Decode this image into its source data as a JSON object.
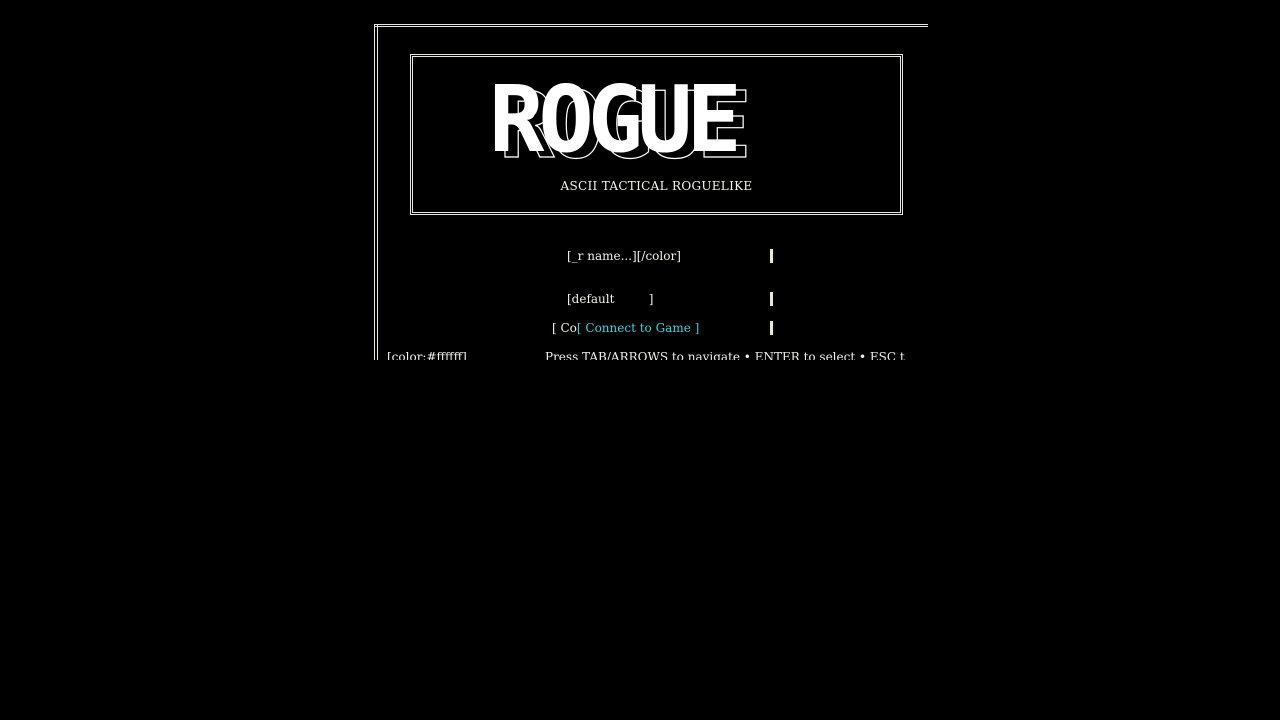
{
  "game": {
    "logo_text": "ROGUE",
    "subtitle": "ASCII TACTICAL ROGUELIKE"
  },
  "form": {
    "name_field": "[_r name...][/color]",
    "server_field": "[default         ]",
    "connect_prefix": "[ Co",
    "connect_label": "[ Connect to Game ]"
  },
  "status_bar": {
    "color_tag": "[color:#ffffff]",
    "hint": "Press TAB/ARROWS to navigate • ENTER to select • ESC t"
  },
  "colors": {
    "background": "#000000",
    "text": "#e8e8d8",
    "accent_cyan": "#2fd6e0"
  }
}
